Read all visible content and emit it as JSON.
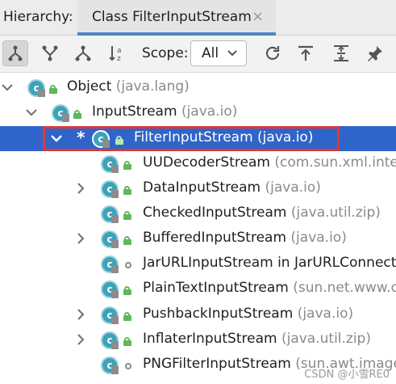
{
  "header": {
    "label": "Hierarchy:",
    "tab_title": "Class FilterInputStream",
    "close_glyph": "×"
  },
  "toolbar": {
    "scope_label": "Scope:",
    "scope_value": "All",
    "buttons": [
      "type-hierarchy-icon",
      "supertypes-icon",
      "subtypes-icon",
      "sort-alphabetically-icon",
      "refresh-icon",
      "export-icon",
      "expand-all-icon",
      "pin-icon"
    ]
  },
  "tree": {
    "rows": [
      {
        "name": "Object",
        "pkg": "(java.lang)",
        "expanded": true
      },
      {
        "name": "InputStream",
        "pkg": "(java.io)",
        "expanded": true
      },
      {
        "name": "FilterInputStream",
        "pkg": "(java.io)",
        "expanded": true,
        "selected": true,
        "marker": "*"
      },
      {
        "name": "UUDecoderStream",
        "pkg": "(com.sun.xml.interr"
      },
      {
        "name": "DataInputStream",
        "pkg": "(java.io)"
      },
      {
        "name": "CheckedInputStream",
        "pkg": "(java.util.zip)"
      },
      {
        "name": "BufferedInputStream",
        "pkg": "(java.io)"
      },
      {
        "name": "JarURLInputStream in JarURLConnectio",
        "pkg": ""
      },
      {
        "name": "PlainTextInputStream",
        "pkg": "(sun.net.www.cor"
      },
      {
        "name": "PushbackInputStream",
        "pkg": "(java.io)"
      },
      {
        "name": "InflaterInputStream",
        "pkg": "(java.util.zip)"
      },
      {
        "name": "PNGFilterInputStream",
        "pkg": "(sun.awt.image)"
      }
    ]
  },
  "watermark": "CSDN @小雪RE0",
  "colors": {
    "accent": "#4a88c7",
    "selection": "#2f65ca",
    "highlight_box": "#d93a3a",
    "class_icon": "#3ea2b8",
    "public_lock": "#5fb85b"
  }
}
